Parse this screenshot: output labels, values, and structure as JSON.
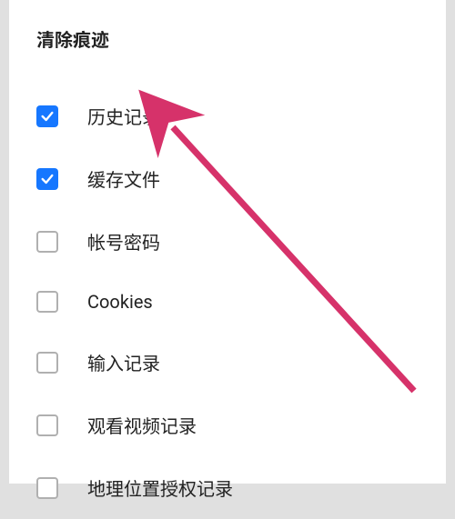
{
  "title": "清除痕迹",
  "options": [
    {
      "label": "历史记录",
      "checked": true
    },
    {
      "label": "缓存文件",
      "checked": true
    },
    {
      "label": "帐号密码",
      "checked": false
    },
    {
      "label": "Cookies",
      "checked": false
    },
    {
      "label": "输入记录",
      "checked": false
    },
    {
      "label": "观看视频记录",
      "checked": false
    },
    {
      "label": "地理位置授权记录",
      "checked": false
    }
  ],
  "colors": {
    "checkbox_checked": "#1677ff",
    "arrow": "#d6326a"
  }
}
